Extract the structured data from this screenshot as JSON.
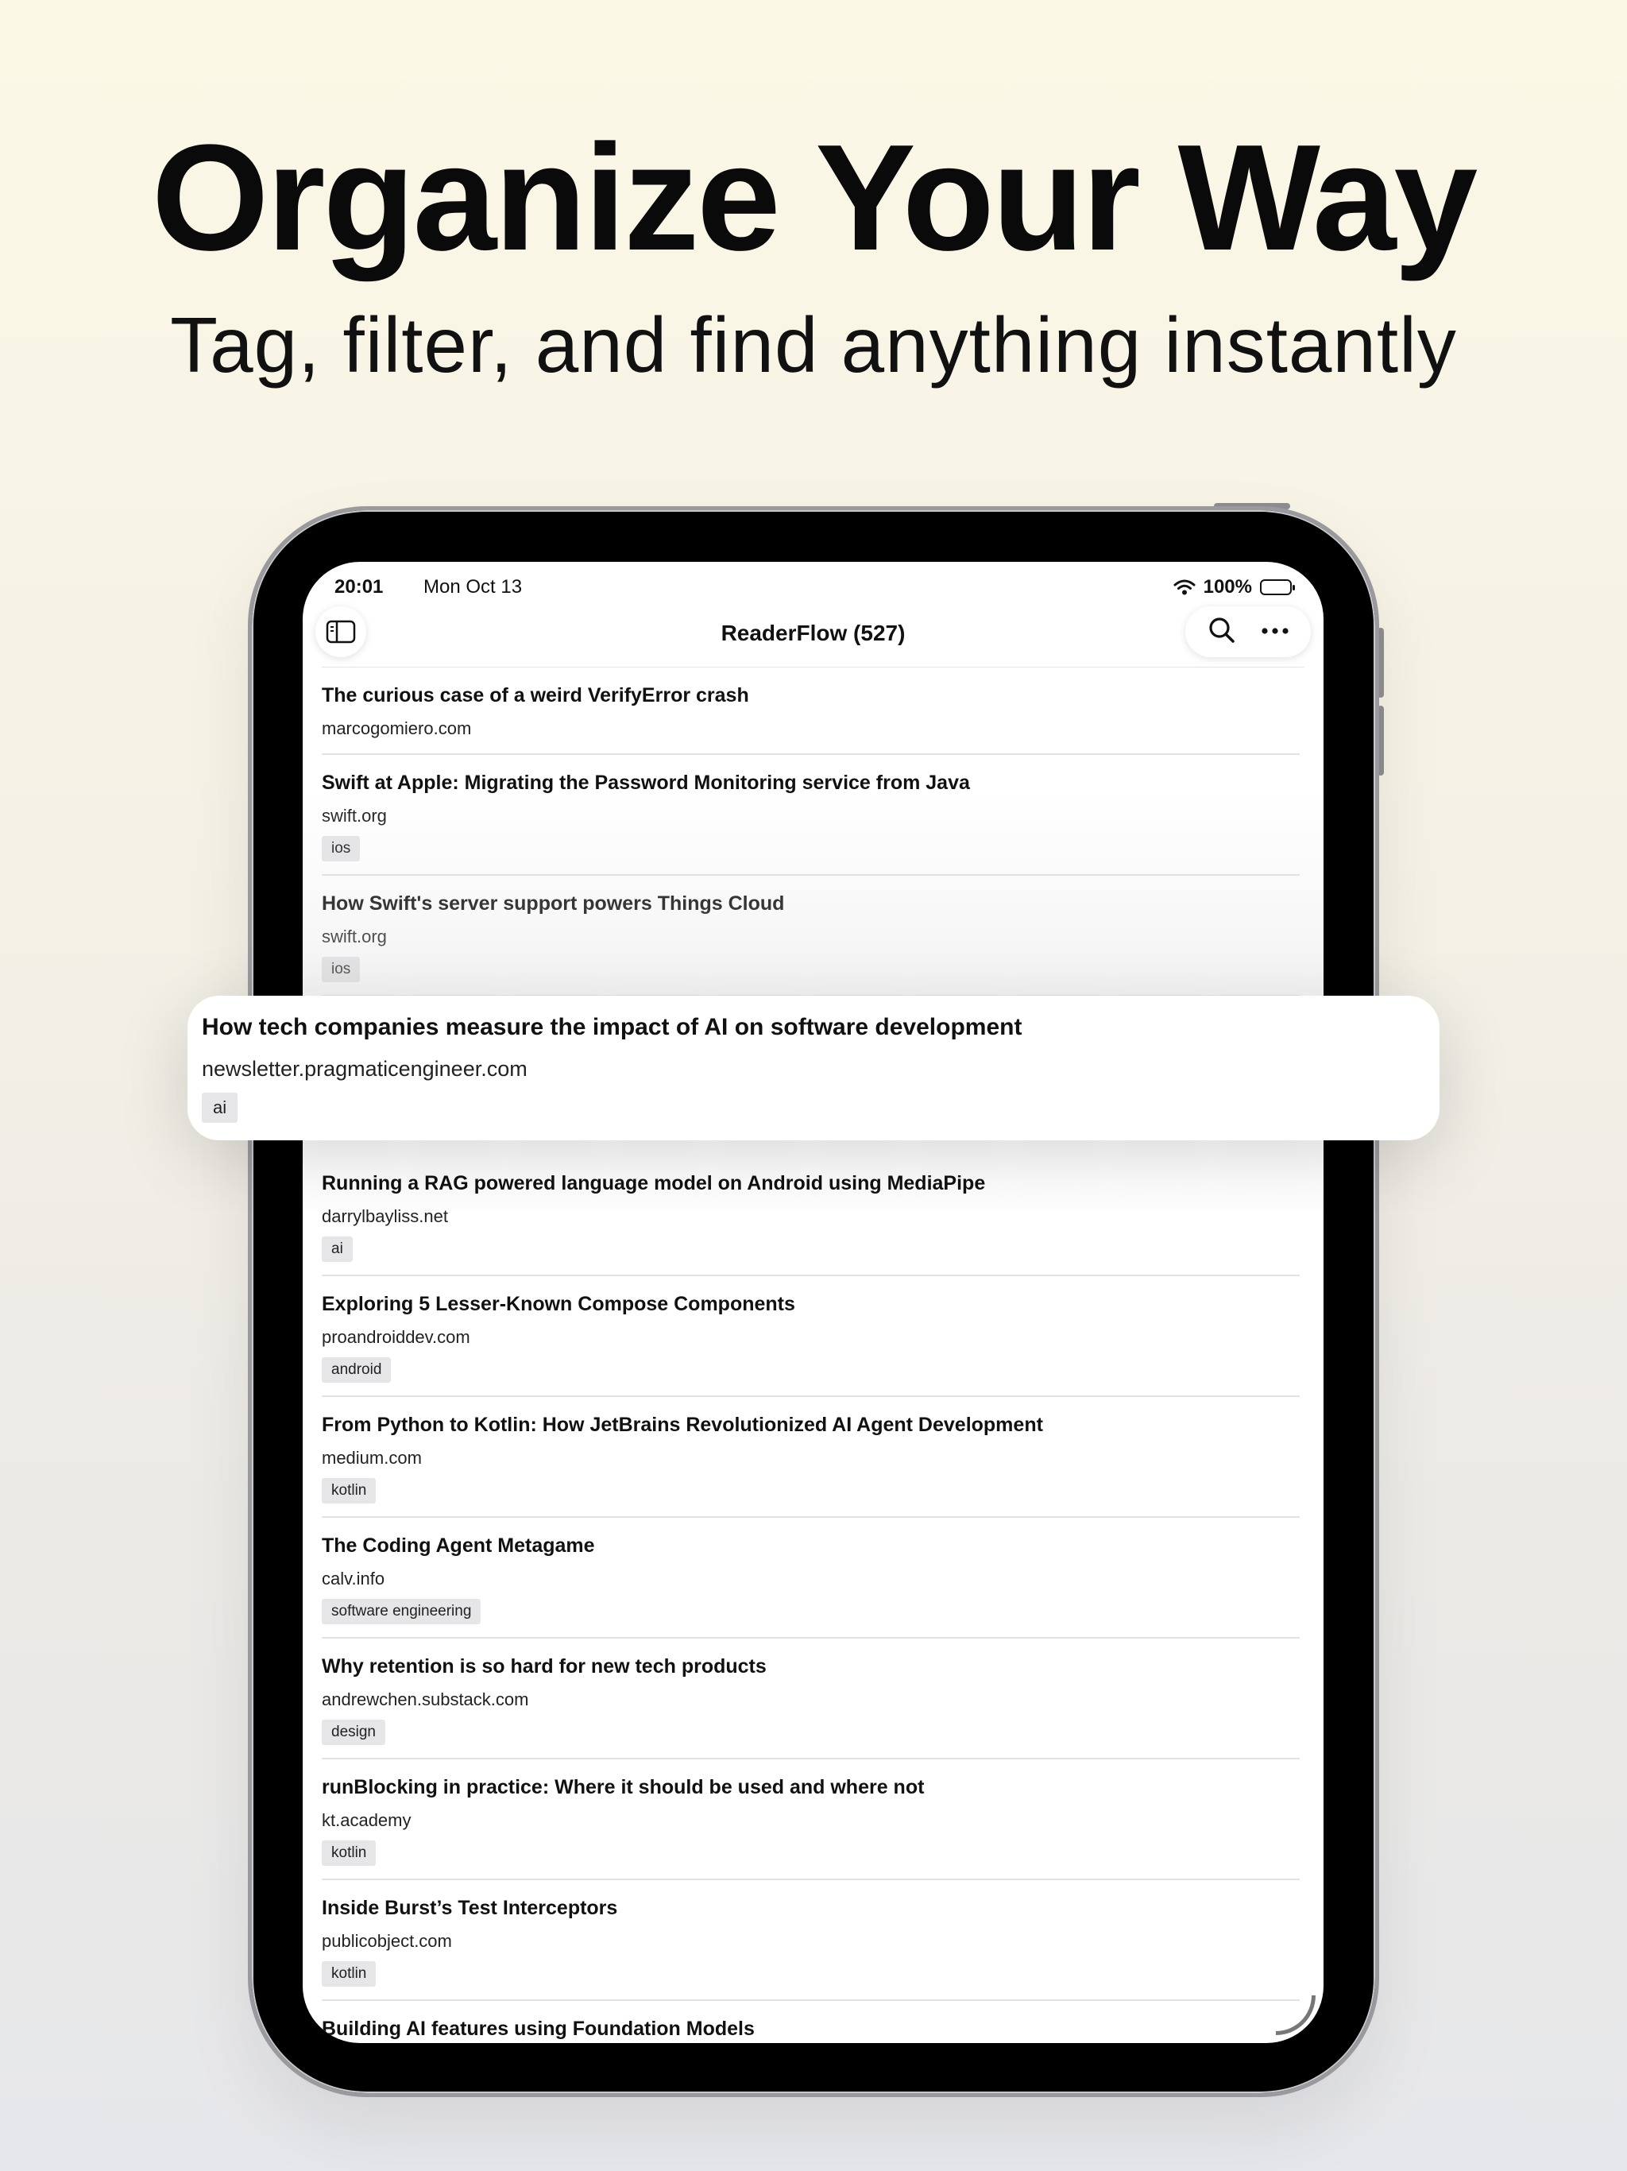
{
  "hero": {
    "title": "Organize Your Way",
    "subtitle": "Tag, filter, and find anything instantly"
  },
  "status_bar": {
    "time": "20:01",
    "date": "Mon Oct 13",
    "battery": "100%"
  },
  "nav": {
    "title": "ReaderFlow (527)",
    "left_icon": "sidebar-icon",
    "right_icons": [
      "search-icon",
      "more-icon"
    ]
  },
  "articles": [
    {
      "title": "The curious case of a weird VerifyError crash",
      "domain": "marcogomiero.com",
      "tag": ""
    },
    {
      "title": "Swift at Apple: Migrating the Password Monitoring service from Java",
      "domain": "swift.org",
      "tag": "ios"
    },
    {
      "title": "How Swift's server support powers Things Cloud",
      "domain": "swift.org",
      "tag": "ios"
    },
    {
      "title": "Running a RAG powered language model on Android using MediaPipe",
      "domain": "darrylbayliss.net",
      "tag": "ai"
    },
    {
      "title": "Exploring 5 Lesser-Known Compose Components",
      "domain": "proandroiddev.com",
      "tag": "android"
    },
    {
      "title": "From Python to Kotlin: How JetBrains Revolutionized AI Agent Development",
      "domain": "medium.com",
      "tag": "kotlin"
    },
    {
      "title": "The Coding Agent Metagame",
      "domain": "calv.info",
      "tag": "software engineering"
    },
    {
      "title": "Why retention is so hard for new tech products",
      "domain": "andrewchen.substack.com",
      "tag": "design"
    },
    {
      "title": "runBlocking in practice: Where it should be used and where not",
      "domain": "kt.academy",
      "tag": "kotlin"
    },
    {
      "title": "Inside Burst’s Test Interceptors",
      "domain": "publicobject.com",
      "tag": "kotlin"
    },
    {
      "title": "Building AI features using Foundation Models",
      "domain": "",
      "tag": ""
    }
  ],
  "highlighted": {
    "title": "How tech companies measure the impact of AI on software development",
    "domain": "newsletter.pragmaticengineer.com",
    "tag": "ai"
  }
}
